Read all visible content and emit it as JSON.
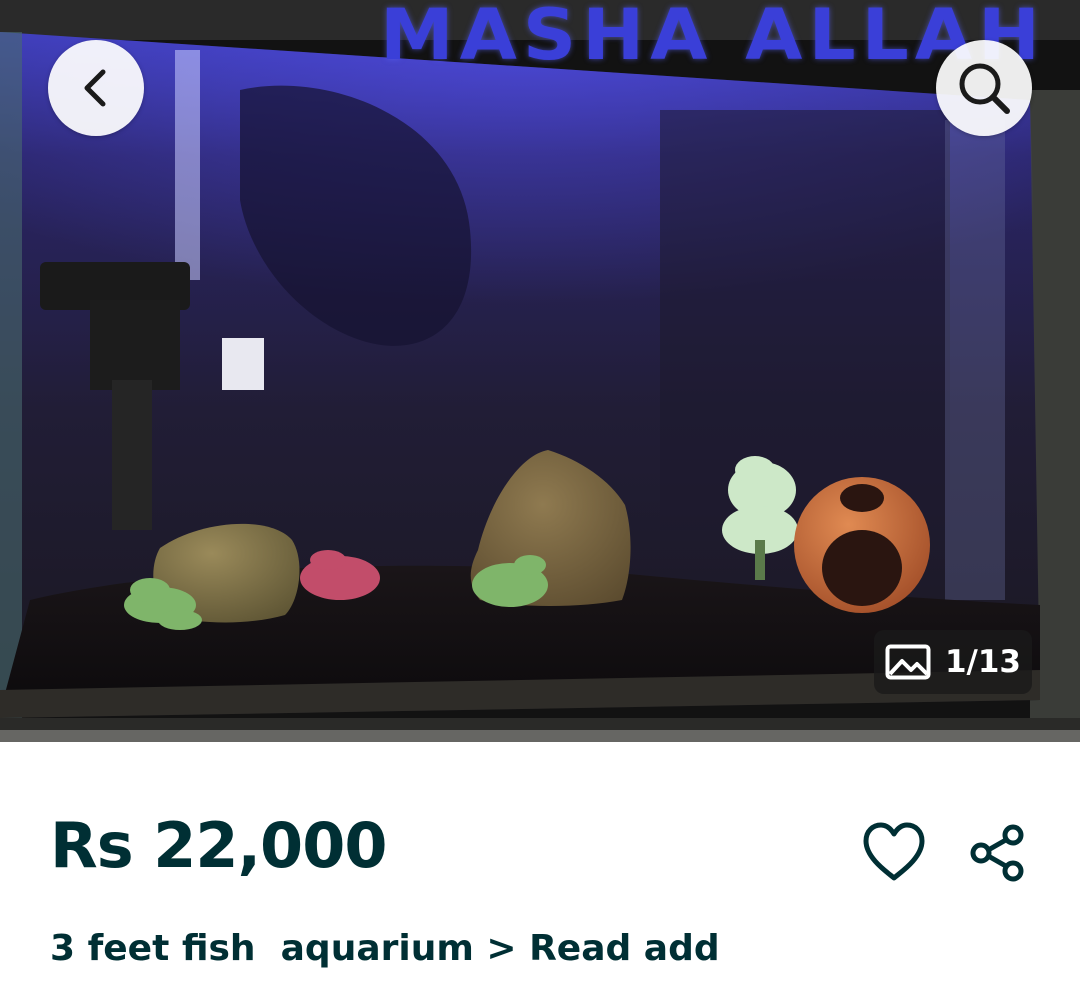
{
  "gallery": {
    "backdrop_text": "MASHA ALLAH",
    "image_counter": "1/13",
    "icons": {
      "back": "chevron-left-icon",
      "search": "search-icon",
      "counter": "image-icon"
    }
  },
  "listing": {
    "price": "Rs 22,000",
    "title": "3 feet fish  aquarium > Read add",
    "icons": {
      "favorite": "heart-icon",
      "share": "share-icon"
    }
  },
  "colors": {
    "text_primary": "#002f34",
    "counter_bg": "#191919",
    "tank_light": "#3a3fd8"
  }
}
